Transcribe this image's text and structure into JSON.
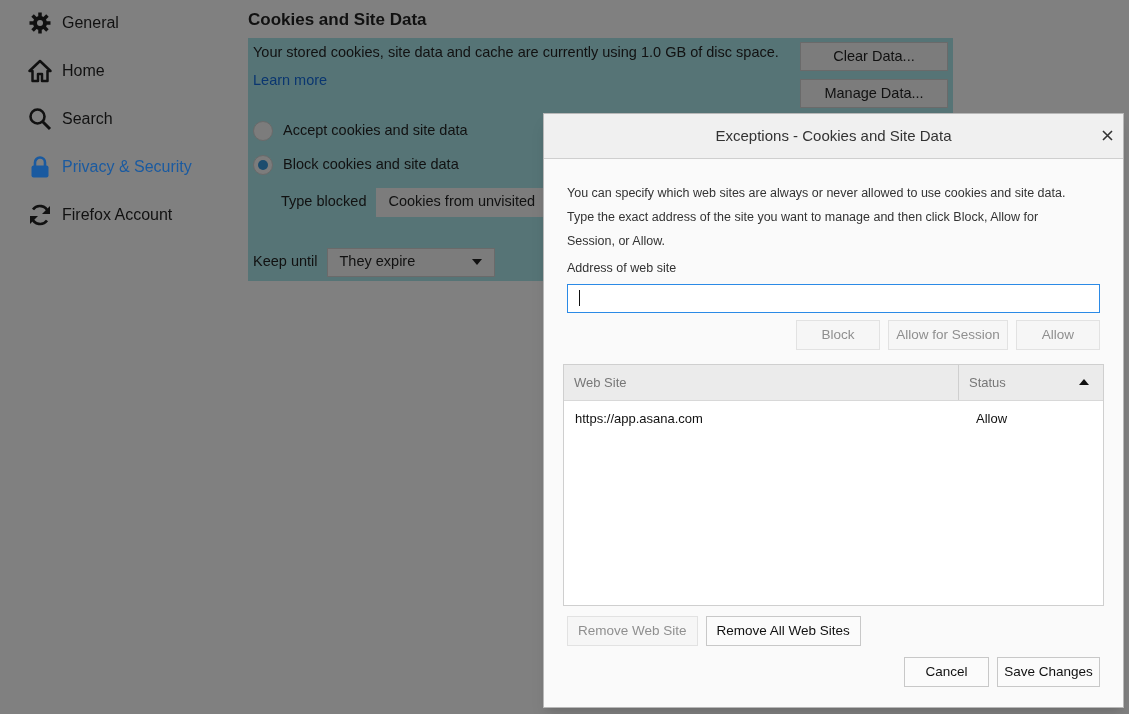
{
  "sidebar": {
    "items": [
      {
        "label": "General",
        "selected": false
      },
      {
        "label": "Home",
        "selected": false
      },
      {
        "label": "Search",
        "selected": false
      },
      {
        "label": "Privacy & Security",
        "selected": true
      },
      {
        "label": "Firefox Account",
        "selected": false
      }
    ]
  },
  "section": {
    "title": "Cookies and Site Data",
    "usage_text": "Your stored cookies, site data and cache are currently using 1.0 GB of disc space.",
    "learn_more": "Learn more",
    "buttons": [
      "Clear Data...",
      "Manage Data..."
    ],
    "options": [
      {
        "label": "Accept cookies and site data",
        "selected": false
      },
      {
        "label": "Block cookies and site data",
        "selected": true
      }
    ],
    "type_blocked": {
      "label": "Type blocked",
      "value": "Cookies from unvisited"
    },
    "keep_until": {
      "label": "Keep until",
      "value": "They expire"
    }
  },
  "dialog": {
    "title": "Exceptions - Cookies and Site Data",
    "description": "You can specify which web sites are always or never allowed to use cookies and site data. Type the exact address of the site you want to manage and then click Block, Allow for Session, or Allow.",
    "address_label": "Address of web site",
    "address_buttons": [
      {
        "label": "Block",
        "disabled": true
      },
      {
        "label": "Allow for Session",
        "disabled": true
      },
      {
        "label": "Allow",
        "disabled": true
      }
    ],
    "table": {
      "columns": [
        {
          "label": "Web Site",
          "sorted": false
        },
        {
          "label": "Status",
          "sorted": true
        }
      ],
      "rows": [
        {
          "site": "https://app.asana.com",
          "status": "Allow"
        }
      ]
    },
    "list_buttons": [
      {
        "label": "Remove Web Site",
        "disabled": true
      },
      {
        "label": "Remove All Web Sites",
        "disabled": false
      }
    ],
    "footer_buttons": [
      "Cancel",
      "Save Changes"
    ]
  }
}
